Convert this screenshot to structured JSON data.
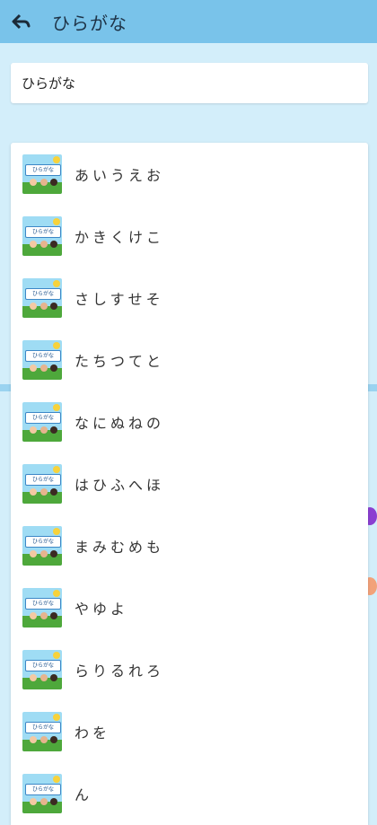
{
  "appbar": {
    "title": "ひらがな",
    "back_icon": "arrow-back-icon"
  },
  "header_card": {
    "text": "ひらがな"
  },
  "thumbnail": {
    "label": "ひらがな",
    "icon": "hiragana-book-thumbnail"
  },
  "items": [
    {
      "label": "あいうえお"
    },
    {
      "label": "かきくけこ"
    },
    {
      "label": "さしすせそ"
    },
    {
      "label": "たちつてと"
    },
    {
      "label": "なにぬねの"
    },
    {
      "label": "はひふへほ"
    },
    {
      "label": "まみむめも"
    },
    {
      "label": "やゆよ"
    },
    {
      "label": "らりるれろ"
    },
    {
      "label": "わを"
    },
    {
      "label": "ん"
    }
  ]
}
